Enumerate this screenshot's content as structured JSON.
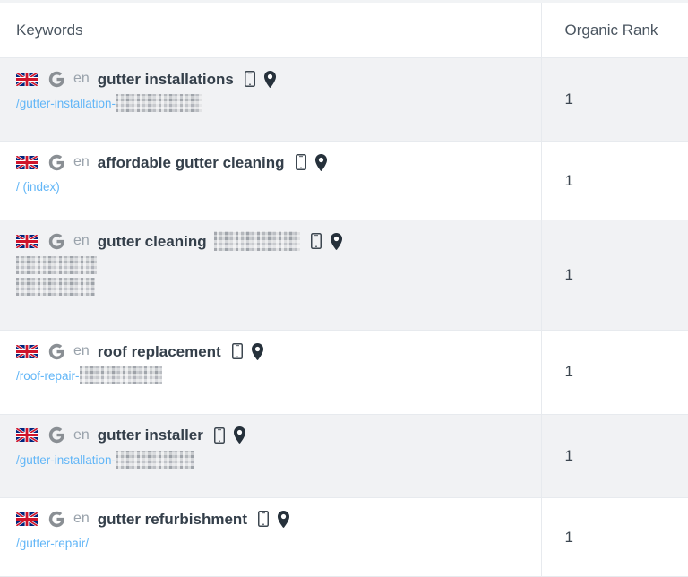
{
  "table": {
    "columns": [
      {
        "key": "keywords",
        "label": "Keywords"
      },
      {
        "key": "organic_rank",
        "label": "Organic Rank"
      }
    ],
    "colors": {
      "row_stripe": "#f1f2f4",
      "row_plain": "#ffffff",
      "border": "#e7eaee",
      "keyword_text": "#343f4a",
      "url_link": "#62b6f7",
      "lang_code": "#9aa3ac",
      "header_text": "#4a5560"
    },
    "rows": [
      {
        "flag": "gb-flag-icon",
        "engine": "google-g-icon",
        "language": "en",
        "keyword": "gutter installations",
        "keyword_redacted": false,
        "device": "mobile-icon",
        "location": "map-pin-icon",
        "url": "/gutter-installation-",
        "url_redacted": true,
        "url_second_line_redacted": false,
        "organic_rank": "1"
      },
      {
        "flag": "gb-flag-icon",
        "engine": "google-g-icon",
        "language": "en",
        "keyword": "affordable gutter cleaning",
        "keyword_redacted": false,
        "device": "mobile-icon",
        "location": "map-pin-icon",
        "url": "/ (index)",
        "url_redacted": false,
        "url_second_line_redacted": false,
        "organic_rank": "1"
      },
      {
        "flag": "gb-flag-icon",
        "engine": "google-g-icon",
        "language": "en",
        "keyword": "gutter cleaning",
        "keyword_redacted": true,
        "device": "mobile-icon",
        "location": "map-pin-icon",
        "url": "",
        "url_redacted": true,
        "url_second_line_redacted": true,
        "organic_rank": "1"
      },
      {
        "flag": "gb-flag-icon",
        "engine": "google-g-icon",
        "language": "en",
        "keyword": "roof replacement",
        "keyword_redacted": false,
        "device": "mobile-icon",
        "location": "map-pin-icon",
        "url": "/roof-repair-",
        "url_redacted": true,
        "url_second_line_redacted": false,
        "organic_rank": "1"
      },
      {
        "flag": "gb-flag-icon",
        "engine": "google-g-icon",
        "language": "en",
        "keyword": "gutter installer",
        "keyword_redacted": false,
        "device": "mobile-icon",
        "location": "map-pin-icon",
        "url": "/gutter-installation-",
        "url_redacted": true,
        "url_second_line_redacted": false,
        "organic_rank": "1"
      },
      {
        "flag": "gb-flag-icon",
        "engine": "google-g-icon",
        "language": "en",
        "keyword": "gutter refurbishment",
        "keyword_redacted": false,
        "device": "mobile-icon",
        "location": "map-pin-icon",
        "url": "/gutter-repair/",
        "url_redacted": false,
        "url_second_line_redacted": false,
        "organic_rank": "1"
      }
    ]
  }
}
